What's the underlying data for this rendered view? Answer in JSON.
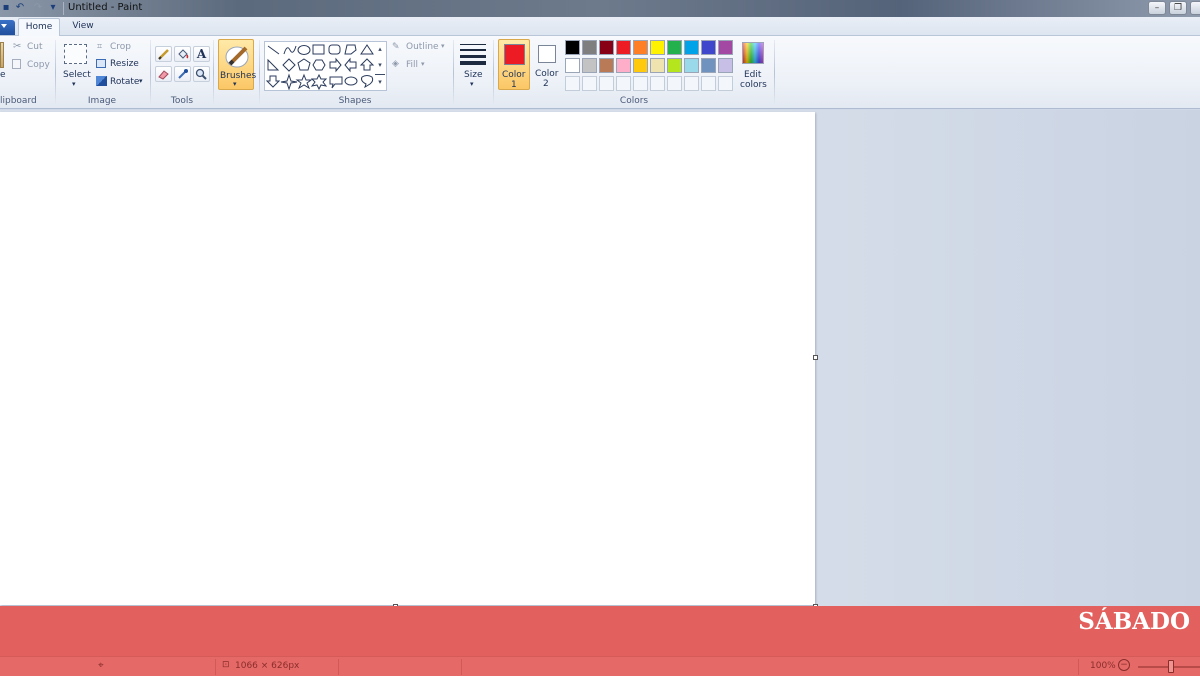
{
  "window": {
    "title": "Untitled - Paint"
  },
  "tabs": [
    {
      "label": "Home",
      "active": true
    },
    {
      "label": "View",
      "active": false
    }
  ],
  "clipboard": {
    "paste_label": "e",
    "cut_label": "Cut",
    "copy_label": "Copy",
    "group_label": "lipboard"
  },
  "image": {
    "select_label": "Select",
    "crop_label": "Crop",
    "resize_label": "Resize",
    "rotate_label": "Rotate",
    "group_label": "Image"
  },
  "tools": {
    "group_label": "Tools",
    "items": [
      "pencil-icon",
      "fill-bucket-icon",
      "text-icon",
      "eraser-icon",
      "color-picker-icon",
      "magnifier-icon"
    ],
    "text_glyph": "A"
  },
  "brushes": {
    "label": "Brushes"
  },
  "shapes": {
    "group_label": "Shapes",
    "outline_label": "Outline",
    "fill_label": "Fill"
  },
  "size": {
    "label": "Size"
  },
  "colors": {
    "group_label": "Colors",
    "color1_line1": "Color",
    "color1_line2": "1",
    "color2_line1": "Color",
    "color2_line2": "2",
    "edit_line1": "Edit",
    "edit_line2": "colors",
    "color1": "#ed1c24",
    "color2": "#ffffff",
    "palette_row1": [
      "#000000",
      "#7f7f7f",
      "#880015",
      "#ed1c24",
      "#ff7f27",
      "#fff200",
      "#22b14c",
      "#00a2e8",
      "#3f48cc",
      "#a349a4"
    ],
    "palette_row2": [
      "#ffffff",
      "#c3c3c3",
      "#b97a57",
      "#ffaec9",
      "#ffc90e",
      "#efe4b0",
      "#b5e61d",
      "#99d9ea",
      "#7092be",
      "#c8bfe7"
    ],
    "custom_slots": 10
  },
  "overlay": {
    "logo": "SÁBADO",
    "band_color": "#e2605d"
  },
  "statusbar": {
    "canvas_size": "1066 × 626px",
    "zoom": "100%"
  }
}
